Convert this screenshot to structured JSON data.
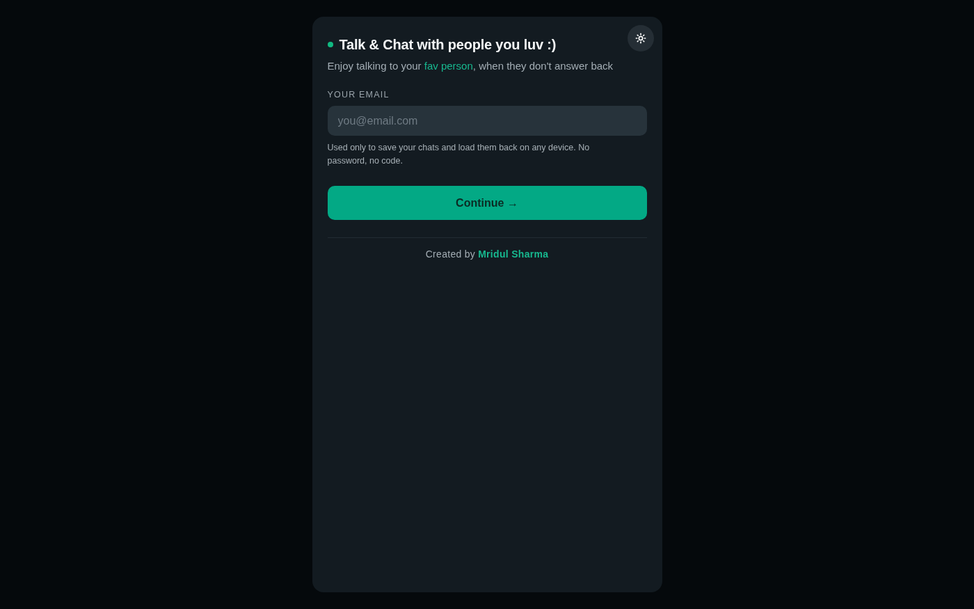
{
  "header": {
    "title": "Talk & Chat with people you luv :)",
    "subtitle": {
      "before": "Enjoy talking to your ",
      "highlight": "fav person",
      "after": ", when they don't answer back"
    }
  },
  "email_field": {
    "label": "YOUR EMAIL",
    "placeholder": "you@email.com",
    "hint": "Used only to save your chats and load them back on any device. No password, no code."
  },
  "continue_button": {
    "label": "Continue →"
  },
  "footer": {
    "prefix": "Created by",
    "link": "Mridul Sharma"
  }
}
